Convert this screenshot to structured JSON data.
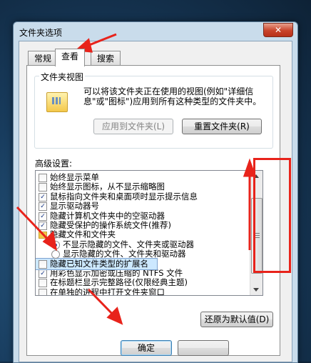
{
  "window": {
    "title": "文件夹选项",
    "close_glyph": "✕"
  },
  "tabs": [
    {
      "label": "常规",
      "active": false
    },
    {
      "label": "查看",
      "active": true
    },
    {
      "label": "搜索",
      "active": false
    }
  ],
  "folder_view": {
    "group_title": "文件夹视图",
    "description": "可以将该文件夹正在使用的视图(例如\"详细信息\"或\"图标\")应用到所有这种类型的文件夹中。",
    "apply_button": "应用到文件夹(L)",
    "reset_button": "重置文件夹(R)"
  },
  "advanced": {
    "label": "高级设置:",
    "items": [
      {
        "text": "始终显示菜单",
        "kind": "checkbox",
        "checked": false,
        "indent": 0
      },
      {
        "text": "始终显示图标，从不显示缩略图",
        "kind": "checkbox",
        "checked": false,
        "indent": 0
      },
      {
        "text": "鼠标指向文件夹和桌面项时显示提示信息",
        "kind": "checkbox",
        "checked": true,
        "indent": 0
      },
      {
        "text": "显示驱动器号",
        "kind": "checkbox",
        "checked": true,
        "indent": 0
      },
      {
        "text": "隐藏计算机文件夹中的空驱动器",
        "kind": "checkbox",
        "checked": true,
        "indent": 0
      },
      {
        "text": "隐藏受保护的操作系统文件(推荐)",
        "kind": "checkbox",
        "checked": true,
        "indent": 0
      },
      {
        "text": "隐藏文件和文件夹",
        "kind": "folder",
        "checked": false,
        "indent": 0
      },
      {
        "text": "不显示隐藏的文件、文件夹或驱动器",
        "kind": "radio",
        "checked": true,
        "indent": 1
      },
      {
        "text": "显示隐藏的文件、文件夹和驱动器",
        "kind": "radio",
        "checked": false,
        "indent": 1
      },
      {
        "text": "隐藏已知文件类型的扩展名",
        "kind": "checkbox",
        "checked": false,
        "indent": 0,
        "highlighted": true
      },
      {
        "text": "用彩色显示加密或压缩的 NTFS 文件",
        "kind": "checkbox",
        "checked": true,
        "indent": 0
      },
      {
        "text": "在标题栏显示完整路径(仅限经典主题)",
        "kind": "checkbox",
        "checked": false,
        "indent": 0
      },
      {
        "text": "在单独的进程中打开文件夹窗口",
        "kind": "checkbox",
        "checked": false,
        "indent": 0
      }
    ]
  },
  "restore_button": "还原为默认值(D)",
  "ok_button": "确定",
  "check_glyph": "✓",
  "colors": {
    "annotation_red": "#e8231b",
    "selection": "#cce8ff"
  }
}
